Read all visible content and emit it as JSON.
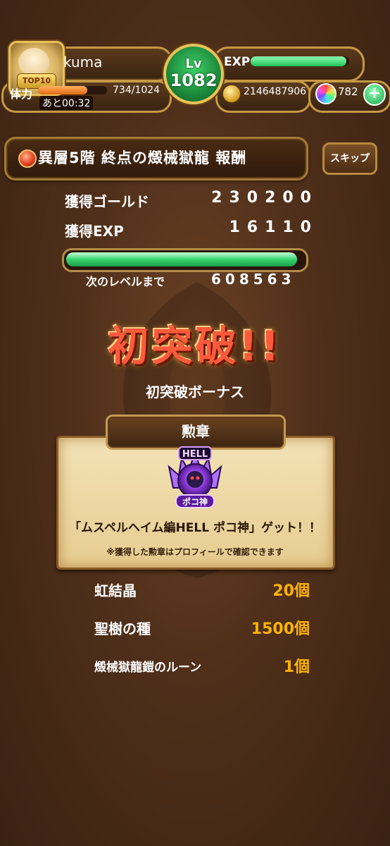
{
  "header": {
    "player_name": "kuma",
    "rank_badge": "TOP10",
    "stamina_label": "体力",
    "stamina_value": "734/1024",
    "stamina_fraction": 0.717,
    "stamina_recover": "あと00:32",
    "level_label": "Lv",
    "level_value": "1082",
    "exp_label": "EXP",
    "exp_fraction": 0.97,
    "gold": "2146487906",
    "gems": "782",
    "plus_icon": "+"
  },
  "quest": {
    "title": "異層5階 終点の燬械獄龍 報酬",
    "skip_label": "スキップ"
  },
  "results": {
    "gold_label": "獲得ゴールド",
    "gold_value": "230200",
    "exp_label": "獲得EXP",
    "exp_value": "16110",
    "next_fraction": 0.97,
    "next_label": "次のレベルまで",
    "next_value": "608563"
  },
  "first_break": {
    "headline": "初突破!!",
    "bonus_label": "初突破ボーナス"
  },
  "medal_card": {
    "heading": "勲章",
    "medal_top_text": "HELL",
    "medal_bottom_text": "ポコ神",
    "got_text": "「ムスペルヘイム編HELL ポコ神」ゲット！！",
    "note_text": "※獲得した勲章はプロフィールで確認できます"
  },
  "rewards": [
    {
      "name": "虹結晶",
      "qty": "20個"
    },
    {
      "name": "聖樹の種",
      "qty": "1500個"
    },
    {
      "name": "燬械獄龍鎧のルーン",
      "qty": "1個"
    }
  ],
  "colors": {
    "accent_green": "#21c25a",
    "qty_orange": "#ffb400",
    "headline_red": "#ff5a3c"
  }
}
